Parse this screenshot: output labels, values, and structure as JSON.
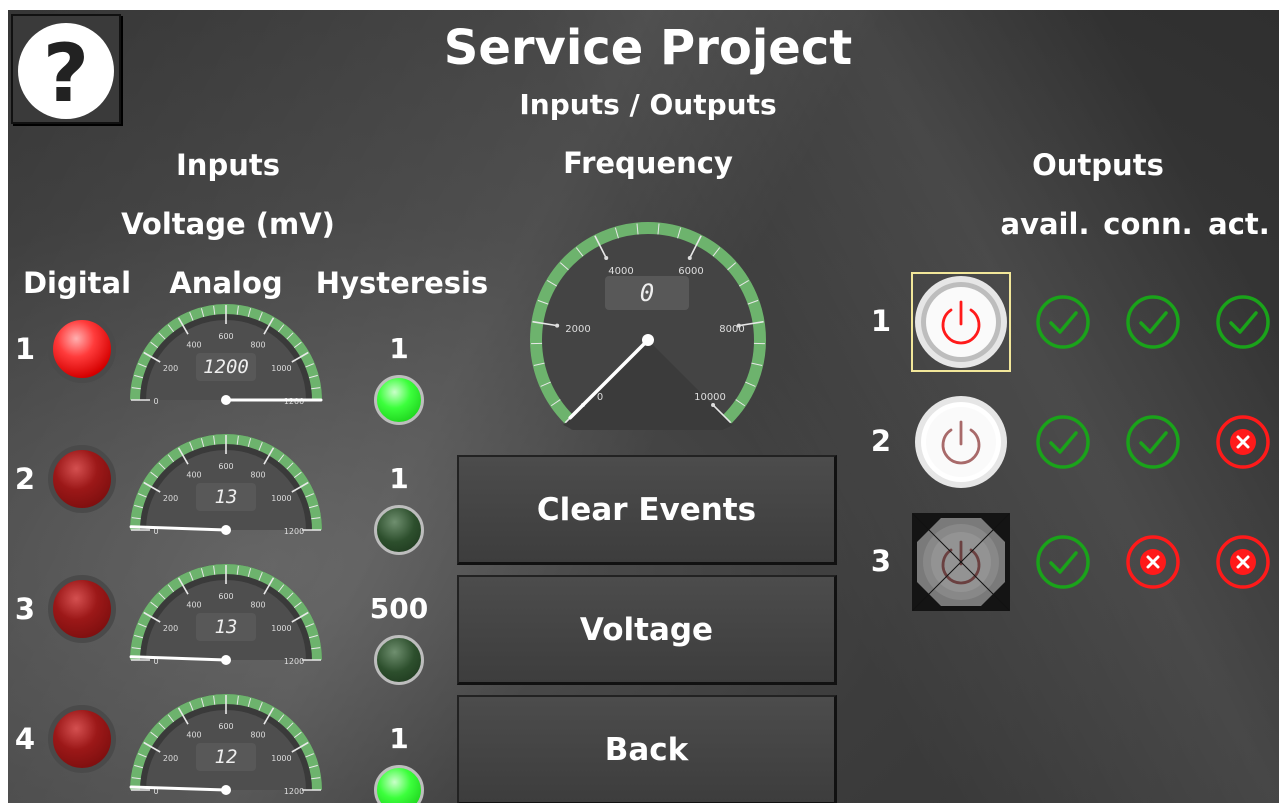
{
  "header": {
    "title": "Service Project",
    "subtitle": "Inputs / Outputs"
  },
  "help": {
    "icon": "question-mark-icon",
    "label": "?"
  },
  "inputs": {
    "title": "Inputs",
    "voltage_label": "Voltage (mV)",
    "col_digital": "Digital",
    "col_analog": "Analog",
    "col_hysteresis": "Hysteresis",
    "rows": [
      {
        "num": "1",
        "digital_on": true,
        "analog": "1200",
        "analog_value": 1200,
        "hysteresis": "1",
        "hyst_on": true
      },
      {
        "num": "2",
        "digital_on": false,
        "analog": "13",
        "analog_value": 13,
        "hysteresis": "1",
        "hyst_on": false
      },
      {
        "num": "3",
        "digital_on": false,
        "analog": "13",
        "analog_value": 13,
        "hysteresis": "500",
        "hyst_on": false
      },
      {
        "num": "4",
        "digital_on": false,
        "analog": "12",
        "analog_value": 12,
        "hysteresis": "1",
        "hyst_on": true
      }
    ],
    "gauge_ticks": [
      "0",
      "200",
      "400",
      "600",
      "800",
      "1000",
      "1200"
    ],
    "gauge_max": 1200
  },
  "frequency": {
    "title": "Frequency",
    "value": "0",
    "value_num": 0,
    "max": 10000,
    "ticks": [
      "0",
      "2000",
      "4000",
      "6000",
      "8000",
      "10000"
    ]
  },
  "buttons": {
    "clear_events": "Clear Events",
    "voltage": "Voltage",
    "back": "Back"
  },
  "outputs": {
    "title": "Outputs",
    "col_avail": "avail.",
    "col_conn": "conn.",
    "col_act": "act.",
    "rows": [
      {
        "num": "1",
        "power_state": "selected",
        "avail": true,
        "conn": true,
        "act": true
      },
      {
        "num": "2",
        "power_state": "normal",
        "avail": true,
        "conn": true,
        "act": false
      },
      {
        "num": "3",
        "power_state": "disabled",
        "avail": true,
        "conn": false,
        "act": false
      }
    ]
  },
  "colors": {
    "ok": "#1aa31a",
    "fail": "#ff1a1a",
    "gauge_arc": "#6db36d",
    "led_red": "#ff2a2a",
    "led_green": "#33ff33"
  }
}
